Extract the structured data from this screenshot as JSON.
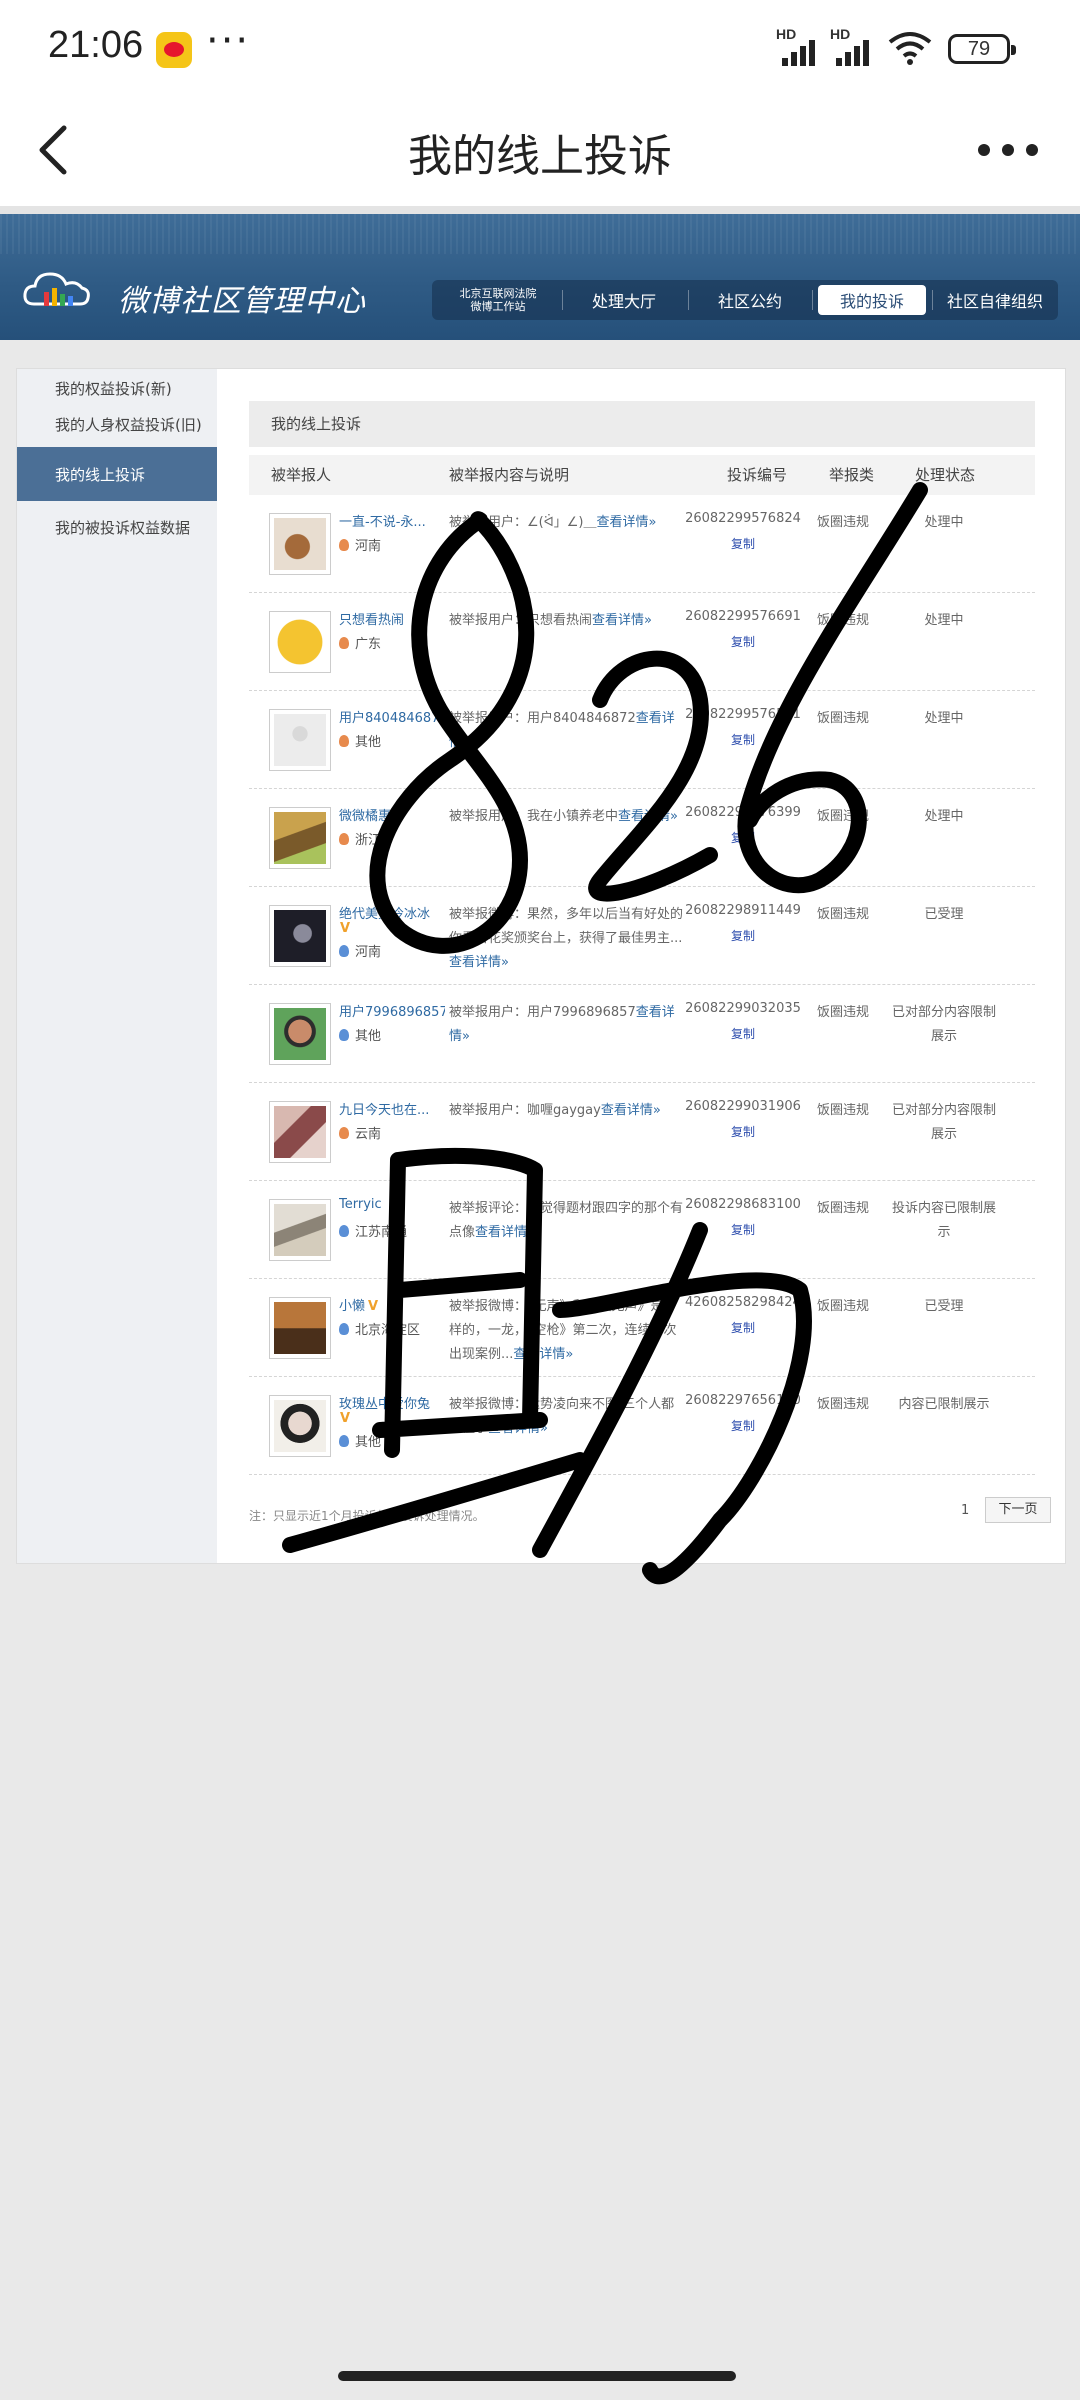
{
  "status_bar": {
    "time": "21:06",
    "dots": "···",
    "hd": "HD",
    "battery": "79"
  },
  "title_bar": {
    "title": "我的线上投诉"
  },
  "header": {
    "logo_text": "微博社区管理中心",
    "nav": [
      {
        "label": "北京互联网法院\n微博工作站"
      },
      {
        "label": "处理大厅"
      },
      {
        "label": "社区公约"
      },
      {
        "label": "我的投诉"
      },
      {
        "label": "社区自律组织"
      }
    ]
  },
  "sidebar": {
    "items": [
      {
        "label": "我的权益投诉(新)"
      },
      {
        "label": "我的人身权益投诉(旧)"
      },
      {
        "label": "我的线上投诉"
      },
      {
        "label": "我的被投诉权益数据"
      }
    ]
  },
  "main": {
    "section_title": "我的线上投诉",
    "columns": [
      "被举报人",
      "被举报内容与说明",
      "投诉编号",
      "举报类",
      "处理状态"
    ],
    "copy_label": "复制",
    "rows": [
      {
        "name": "一直-不说-永...",
        "location": "河南",
        "desc": "被举报用户：∠(ᐛ」∠)＿",
        "link": "查看详情»",
        "id": "26082299576824",
        "type": "饭圈违规",
        "status": "处理中"
      },
      {
        "name": "只想看热闹",
        "location": "广东",
        "desc": "被举报用户：只想看热闹",
        "link": "查看详情»",
        "id": "26082299576691",
        "type": "饭圈违规",
        "status": "处理中"
      },
      {
        "name": "用户8404846872",
        "location": "其他",
        "desc": "被举报用户：用户8404846872",
        "link": "查看详情»",
        "id": "26082299576591",
        "type": "饭圈违规",
        "status": "处理中"
      },
      {
        "name": "微微橘惠",
        "location": "浙江",
        "desc": "被举报用户：我在小镇养老中",
        "link": "查看详情»",
        "id": "26082299576399",
        "type": "饭圈违规",
        "status": "处理中"
      },
      {
        "name": "绝代美男冷冰冰",
        "location": "河南",
        "desc": "被举报微博：果然，多年以后当有好处的你看百花奖颁奖台上，获得了最佳男主...",
        "link": "查看详情»",
        "id": "26082298911449",
        "type": "饭圈违规",
        "status": "已受理"
      },
      {
        "name": "用户7996896857",
        "location": "其他",
        "desc": "被举报用户：用户7996896857",
        "link": "查看详情»",
        "id": "26082299032035",
        "type": "饭圈违规",
        "status": "已对部分内容限制展示"
      },
      {
        "name": "九日今天也在...",
        "location": "云南",
        "desc": "被举报用户：咖喱gaygay",
        "link": "查看详情»",
        "id": "26082299031906",
        "type": "饭圈违规",
        "status": "已对部分内容限制展示"
      },
      {
        "name": "Terryic",
        "location": "江苏南通",
        "desc": "被举报评论：我觉得题材跟四字的那个有点像",
        "link": "查看详情»",
        "id": "26082298683100",
        "type": "饭圈违规",
        "status": "投诉内容已限制展示"
      },
      {
        "name": "小懒",
        "location": "北京海淀区",
        "desc": "被举报微博：《无声》和《蛰无声》是一样的，一龙，《空枪》第二次，连续两次出现案例...",
        "link": "查看详情»",
        "id": "426082582984248",
        "type": "饭圈违规",
        "status": "已受理"
      },
      {
        "name": "玫瑰丛中爱你兔",
        "location": "其他",
        "desc": "被举报微博：运势凌向来不图 三个人都顶住了",
        "link": "查看详情»",
        "id": "26082297656140",
        "type": "饭圈违规",
        "status": "内容已限制展示"
      }
    ],
    "note": "注：只显示近1个月投诉的，投诉处理情况。",
    "pagination": {
      "page": "1",
      "next": "下一页"
    }
  },
  "handwriting": {
    "line1": "826",
    "line2": "日助"
  },
  "colors": {
    "header_blue": "#2f5b85",
    "active_blue": "#4b6f96",
    "link_blue": "#2f6aa3"
  }
}
